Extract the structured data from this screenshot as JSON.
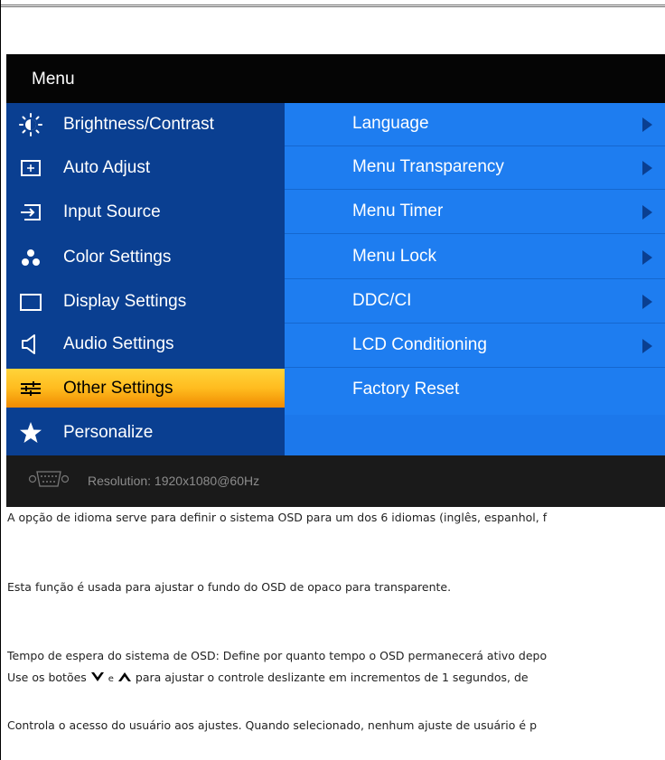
{
  "osd": {
    "title": "Menu",
    "left_menu": [
      {
        "label": "Brightness/Contrast",
        "icon": "brightness-icon"
      },
      {
        "label": "Auto Adjust",
        "icon": "auto-adjust-icon"
      },
      {
        "label": "Input Source",
        "icon": "input-source-icon"
      },
      {
        "label": "Color Settings",
        "icon": "color-settings-icon"
      },
      {
        "label": "Display Settings",
        "icon": "display-settings-icon"
      },
      {
        "label": "Audio Settings",
        "icon": "speaker-icon"
      },
      {
        "label": "Other Settings",
        "icon": "sliders-icon",
        "selected": true
      },
      {
        "label": "Personalize",
        "icon": "star-icon"
      }
    ],
    "right_menu": [
      {
        "label": "Language",
        "has_submenu": true
      },
      {
        "label": "Menu Transparency",
        "has_submenu": true
      },
      {
        "label": "Menu Timer",
        "has_submenu": true
      },
      {
        "label": "Menu Lock",
        "has_submenu": true
      },
      {
        "label": "DDC/CI",
        "has_submenu": true
      },
      {
        "label": "LCD Conditioning",
        "has_submenu": true
      },
      {
        "label": "Factory Reset",
        "has_submenu": false
      }
    ],
    "footer": {
      "resolution_text": "Resolution:  1920x1080@60Hz",
      "icon": "vga-connector-icon"
    },
    "colors": {
      "left_panel": "#0a3f91",
      "right_panel": "#1e7df0",
      "selected_highlight": "#ffbc1f",
      "header": "#050505",
      "footer": "#1a1a1a"
    }
  },
  "descriptions": {
    "language": "A opção de idioma serve para definir o sistema OSD para um dos 6 idiomas (inglês, espanhol, f",
    "transparency": "Esta função é usada para ajustar o fundo do OSD de opaco para transparente.",
    "timer_1": "Tempo de espera do sistema de OSD: Define por quanto tempo o OSD permanecerá ativo depo",
    "timer_2_pre": "Use os botões",
    "timer_2_mid": "e",
    "timer_2_post": "para ajustar o controle deslizante em incrementos de 1 segundos, de",
    "lock": "Controla o acesso do usuário aos ajustes. Quando selecionado, nenhum ajuste de usuário é p"
  }
}
